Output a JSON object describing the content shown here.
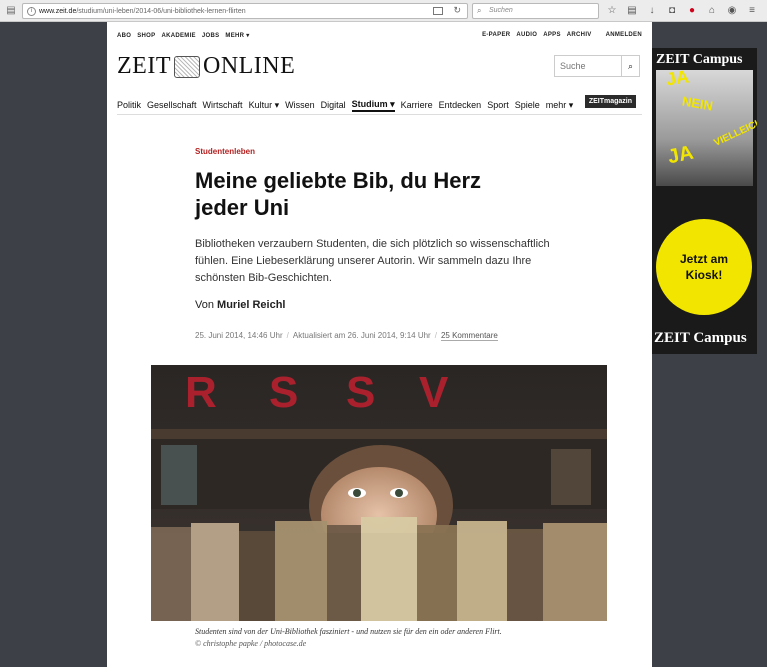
{
  "browser": {
    "url_host": "www.zeit.de",
    "url_path": "/studium/uni-leben/2014-06/uni-bibliothek-lernen-flirten",
    "search_placeholder": "Suchen"
  },
  "site": {
    "top_left_links": [
      "ABO",
      "SHOP",
      "AKADEMIE",
      "JOBS",
      "MEHR ▾"
    ],
    "top_right_links": [
      "E-PAPER",
      "AUDIO",
      "APPS",
      "ARCHIV",
      "ANMELDEN"
    ],
    "logo_left": "ZEIT",
    "logo_right": "ONLINE",
    "search_placeholder": "Suche",
    "nav": [
      "Politik",
      "Gesellschaft",
      "Wirtschaft",
      "Kultur ▾",
      "Wissen",
      "Digital",
      "Studium ▾",
      "Karriere",
      "Entdecken",
      "Sport",
      "Spiele",
      "mehr ▾"
    ],
    "nav_active": "Studium ▾",
    "zeitmagazin": "ZEITmagazin"
  },
  "article": {
    "kicker": "Studentenleben",
    "headline": "Meine geliebte Bib, du Herz jeder Uni",
    "summary": "Bibliotheken verzaubern Studenten, die sich plötzlich so wissenschaftlich fühlen. Eine Liebeserklärung unserer Autorin. Wir sammeln dazu Ihre schönsten Bib-Geschichten.",
    "byline_prefix": "Von",
    "author": "Muriel Reichl",
    "published": "25. Juni 2014, 14:46 Uhr",
    "updated": "Aktualisiert am 26. Juni 2014, 9:14 Uhr",
    "comments": "25 Kommentare",
    "caption": "Studenten sind von der Uni-Bibliothek fasziniert - und nutzen sie für den ein oder anderen Flirt.",
    "credit": "© christophe papke / photocase.de",
    "photo_letters": [
      "R",
      "S",
      "S",
      "V"
    ]
  },
  "ad": {
    "brand": "ZEIT Campus",
    "scribbles": [
      "JA",
      "NEIN",
      "VIELLEICHT",
      "JA"
    ],
    "cta": "Jetzt am Kiosk!"
  },
  "icons": {
    "prev": "chevron-left-icon",
    "next": "chevron-right-icon"
  }
}
